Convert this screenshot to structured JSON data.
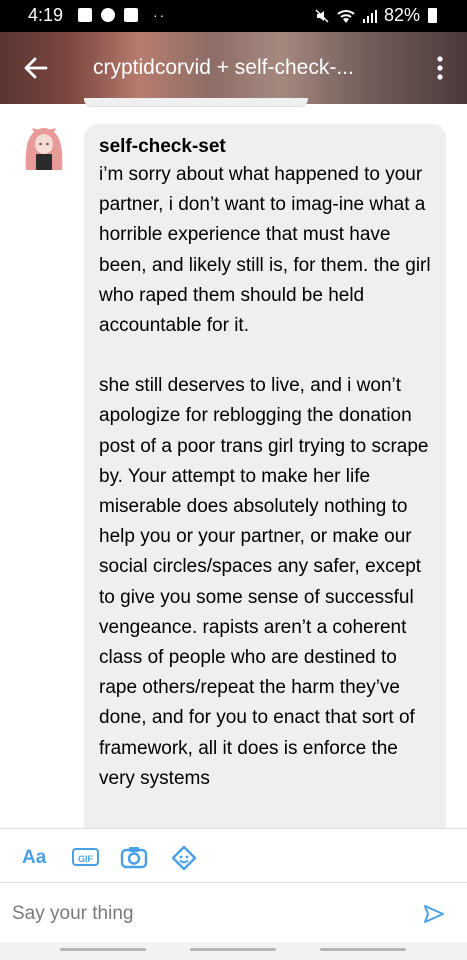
{
  "status_bar": {
    "time": "4:19",
    "battery": "82%",
    "left_icons": [
      "facebook-icon",
      "pinterest-icon",
      "folder-icon"
    ],
    "right_icons": [
      "mute-icon",
      "wifi-icon",
      "signal-icon",
      "battery-icon"
    ]
  },
  "header": {
    "title": "cryptidcorvid + self-check-...",
    "back_icon": "back-arrow-icon",
    "menu_icon": "more-vertical-icon"
  },
  "message": {
    "sender": "self-check-set",
    "paragraphs": [
      "i’m sorry about what happened to your partner, i don’t want to imag-ine what a horrible experience that must have been, and likely still is, for them. the girl who raped them should be held accountable for it.",
      "she still deserves to live, and i won’t apologize for reblogging the donation post of a poor trans girl trying to scrape by. Your attempt to make her life miserable does absolutely nothing to help you or your partner, or make our social circles/spaces any safer, except to give you some sense of successful vengeance. rapists aren’t a coherent class of people who are destined to rape others/repeat the harm they’ve done, and for you to enact that sort of framework, all it does is enforce the very systems"
    ]
  },
  "composer": {
    "text_tool": "Aa",
    "gif_tool": "GIF",
    "placeholder": "Say your thing"
  },
  "colors": {
    "accent": "#4aa0e8",
    "bubble": "#efefef",
    "status_bar": "#000000"
  }
}
